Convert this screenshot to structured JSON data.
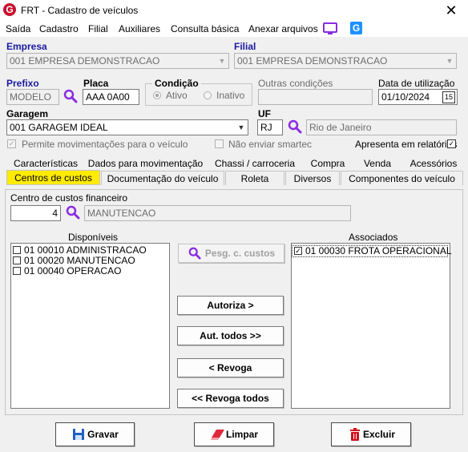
{
  "window": {
    "title": "FRT - Cadastro de veículos",
    "app_icon_glyph": "G",
    "brand_color": "#c8102e"
  },
  "menu": {
    "items": [
      "Saída",
      "Cadastro",
      "Filial",
      "Auxiliares",
      "Consulta básica",
      "Anexar arquivos"
    ]
  },
  "empresa": {
    "label": "Empresa",
    "value": "001 EMPRESA DEMONSTRACAO"
  },
  "filial": {
    "label": "Filial",
    "value": "001 EMPRESA DEMONSTRACAO"
  },
  "prefixo": {
    "label": "Prefixo",
    "value": "MODELO"
  },
  "placa": {
    "label": "Placa",
    "value": "AAA 0A00"
  },
  "condicao": {
    "label": "Condição",
    "ativo": "Ativo",
    "inativo": "Inativo",
    "selected": "Ativo"
  },
  "outras_condicoes": {
    "label": "Outras condições",
    "value": ""
  },
  "data_utilizacao": {
    "label": "Data de utilização",
    "value": "01/10/2024",
    "calendar_glyph": "15"
  },
  "garagem": {
    "label": "Garagem",
    "value": "001 GARAGEM IDEAL"
  },
  "uf": {
    "label": "UF",
    "value": "RJ",
    "nome": "Rio de Janeiro"
  },
  "permite_mov": {
    "label": "Permite movimentações para o veículo",
    "checked": true
  },
  "nao_enviar": {
    "label": "Não enviar smartec",
    "checked": false
  },
  "apresenta_relatorios": {
    "label": "Apresenta em relatórios",
    "checked": true
  },
  "tabs_row1": [
    "Características",
    "Dados para movimentação",
    "Chassi / carroceria",
    "Compra",
    "Venda",
    "Acessórios"
  ],
  "tabs_row2": [
    "Centros de custos",
    "Documentação do veículo",
    "Roleta",
    "Diversos",
    "Componentes do veículo"
  ],
  "active_tab": "Centros de custos",
  "centro_custos": {
    "label": "Centro de custos financeiro",
    "code": "4",
    "name": "MANUTENCAO"
  },
  "disponiveis": {
    "header": "Disponíveis",
    "items": [
      {
        "label": "01 00010 ADMINISTRACAO",
        "checked": false
      },
      {
        "label": "01 00020 MANUTENCAO",
        "checked": false
      },
      {
        "label": "01 00040 OPERACAO",
        "checked": false
      }
    ]
  },
  "associados": {
    "header": "Associados",
    "items": [
      {
        "label": "01 00030 FROTA OPERACIONAL",
        "checked": true
      }
    ]
  },
  "buttons": {
    "pesquisa": "Pesg. c. custos",
    "autoriza": "Autoriza >",
    "aut_todos": "Aut. todos >>",
    "revoga": "< Revoga",
    "revoga_todos": "<< Revoga todos",
    "gravar": "Gravar",
    "limpar": "Limpar",
    "excluir": "Excluir"
  },
  "colors": {
    "active_tab": "#ffeb00",
    "label_blue": "#1a1aa0",
    "magnifier": "#8a2be2"
  }
}
